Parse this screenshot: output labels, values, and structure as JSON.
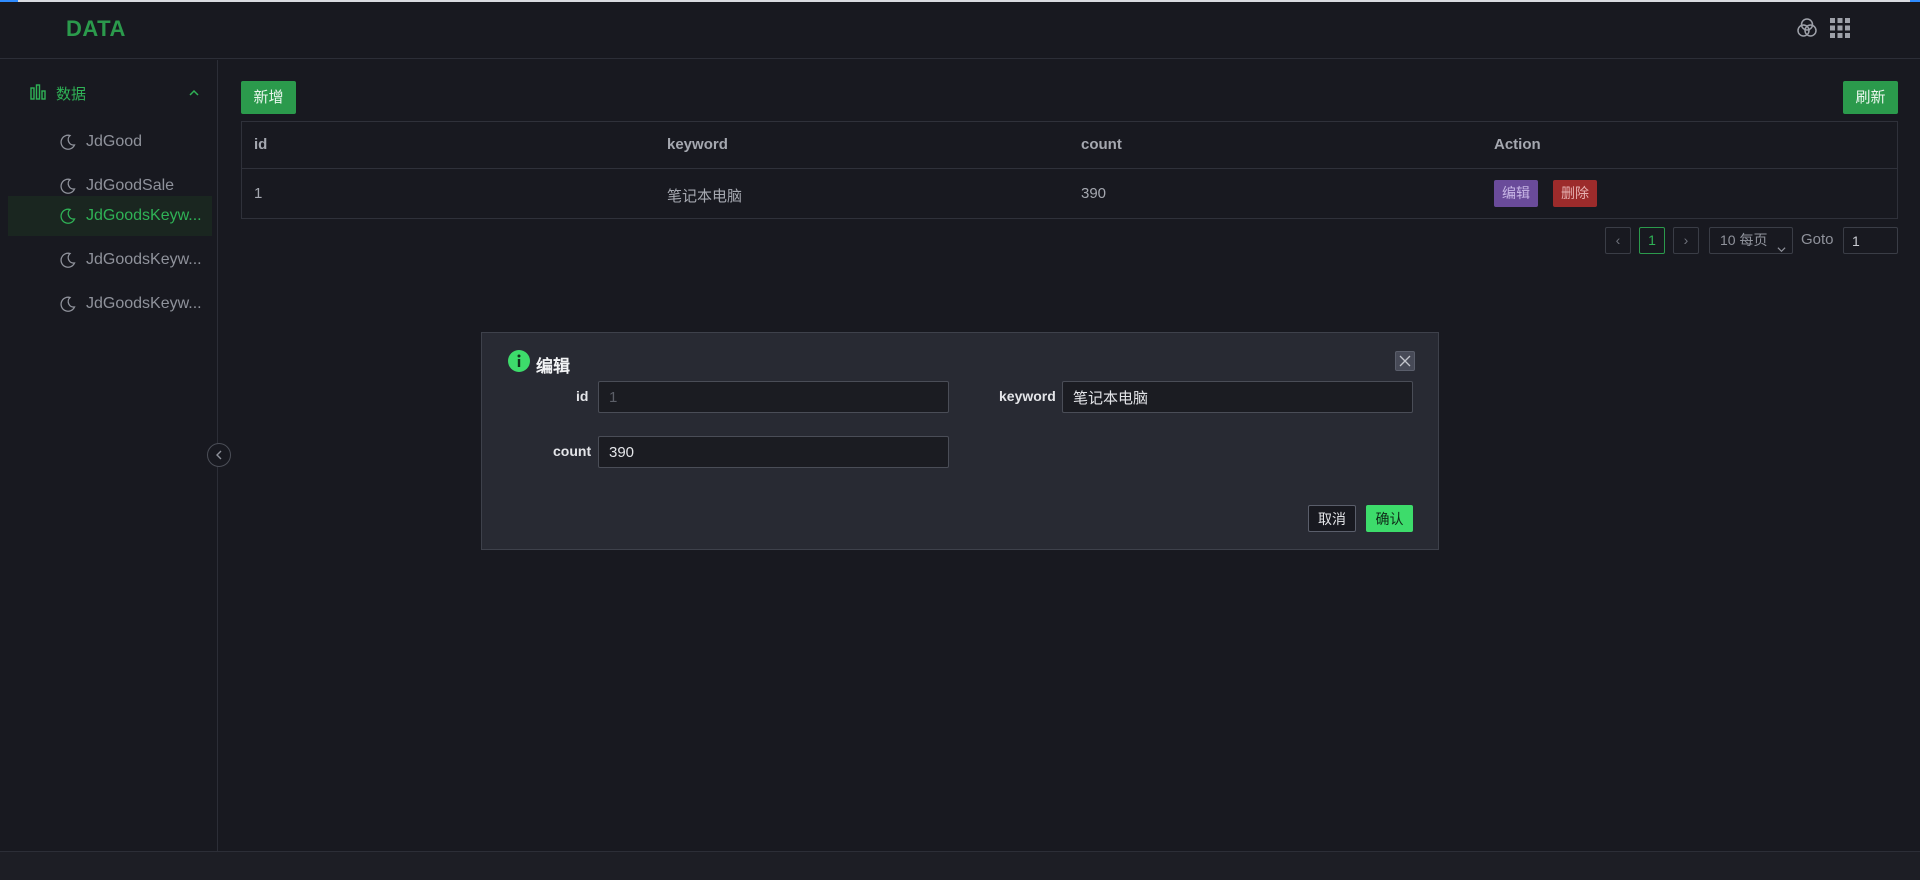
{
  "header": {
    "logo": "DATA",
    "icons": [
      "color-circles-icon",
      "apps-grid-icon"
    ]
  },
  "sidebar": {
    "group": {
      "label": "数据",
      "icon": "bar-chart-icon",
      "expanded": true
    },
    "items": [
      {
        "label": "JdGood",
        "icon": "moon-icon",
        "active": false
      },
      {
        "label": "JdGoodSale",
        "icon": "moon-icon",
        "active": false
      },
      {
        "label": "JdGoodsKeyw...",
        "icon": "moon-icon",
        "active": true
      },
      {
        "label": "JdGoodsKeyw...",
        "icon": "moon-icon",
        "active": false
      },
      {
        "label": "JdGoodsKeyw...",
        "icon": "moon-icon",
        "active": false
      }
    ]
  },
  "toolbar": {
    "add_label": "新增",
    "refresh_label": "刷新"
  },
  "table": {
    "columns": [
      "id",
      "keyword",
      "count",
      "Action"
    ],
    "rows": [
      {
        "id": "1",
        "keyword": "笔记本电脑",
        "count": "390",
        "edit_label": "编辑",
        "delete_label": "删除"
      }
    ]
  },
  "pagination": {
    "prev": "‹",
    "current": "1",
    "next": "›",
    "page_size": "10 每页",
    "goto_label": "Goto",
    "goto_value": "1"
  },
  "modal": {
    "title": "编辑",
    "fields": {
      "id": {
        "label": "id",
        "value": "1"
      },
      "keyword": {
        "label": "keyword",
        "value": "笔记本电脑"
      },
      "count": {
        "label": "count",
        "value": "390"
      }
    },
    "cancel_label": "取消",
    "ok_label": "确认"
  },
  "colors": {
    "accent": "#2b9a4c",
    "background": "#181920",
    "edit": "#6a4b9a",
    "delete": "#9c2b2b",
    "confirm": "#3ddc6b"
  }
}
